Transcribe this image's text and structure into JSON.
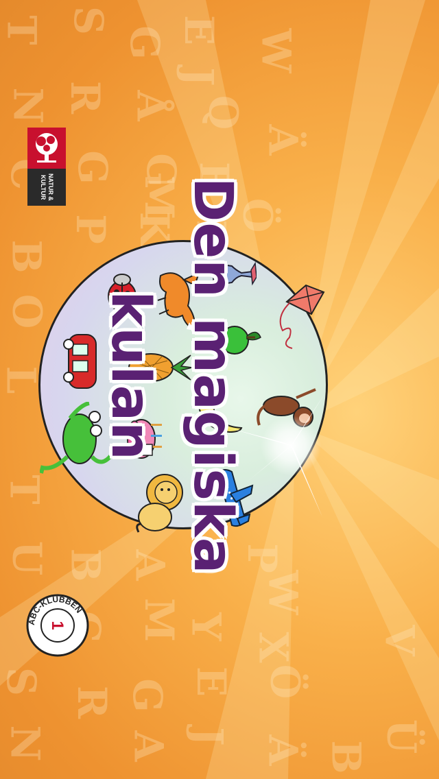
{
  "app": {
    "title": "Den magiska kulan",
    "publisher_logo_text": "NATUR & KULTUR",
    "series_badge_text": "ABC-KLUBBEN",
    "series_badge_number": "1"
  },
  "background_letters": [
    "S",
    "T",
    "E",
    "G",
    "J",
    "Å",
    "R",
    "W",
    "Q",
    "N",
    "Ä",
    "G",
    "E",
    "G",
    "C",
    "M",
    "Ö",
    "I",
    "P",
    "K",
    "B",
    "O",
    "L",
    "T",
    "U",
    "B",
    "A",
    "O",
    "P",
    "W",
    "C",
    "M",
    "Y",
    "X",
    "E",
    "Ö",
    "G",
    "R",
    "A",
    "J",
    "Ä",
    "Ü",
    "S",
    "N",
    "V",
    "B"
  ],
  "ball_items": [
    "ladybug-icon",
    "fox-icon",
    "vase-icon",
    "kite-icon",
    "car-icon",
    "pineapple-icon",
    "apple-icon",
    "moon-icon",
    "monkey-icon",
    "frog-icon",
    "cake-icon",
    "lion-icon",
    "airplane-icon"
  ],
  "colors": {
    "background": "#f3a33d",
    "title": "#5a2173",
    "ball_border": "#222222",
    "logo_red": "#c8102e"
  }
}
